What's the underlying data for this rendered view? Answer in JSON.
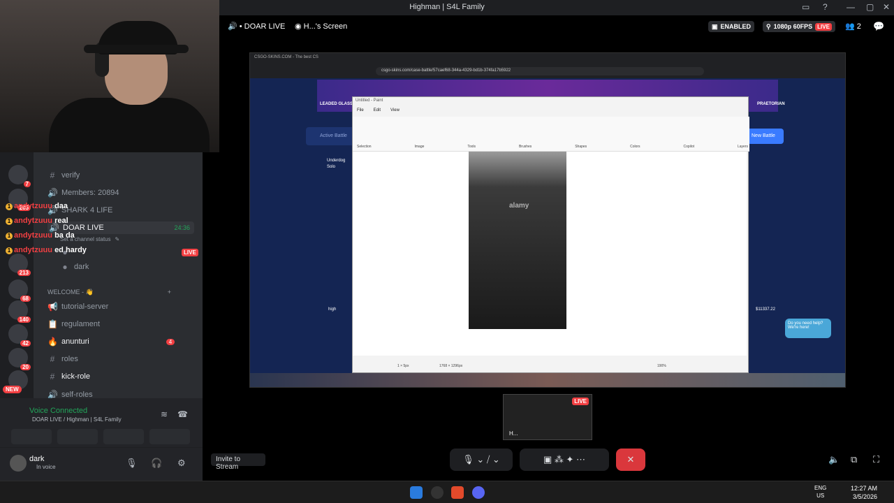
{
  "window": {
    "title": "Highman | S4L Family",
    "controls": [
      "—",
      "▢",
      "✕"
    ]
  },
  "stream_header": {
    "tab_live": "DOAR LIVE",
    "tab_screen": "H...'s Screen",
    "enabled": "ENABLED",
    "quality": "1080p 60FPS",
    "live": "LIVE",
    "viewers": "2"
  },
  "channels": {
    "items": [
      {
        "icon": "#",
        "label": "verify"
      },
      {
        "icon": "🔊",
        "label": "Members: 20894"
      },
      {
        "icon": "🔊",
        "label": "SHARK 4 LIFE"
      },
      {
        "icon": "🔊",
        "label": "DOAR LIVE",
        "time": "24:36"
      },
      {
        "icon": "",
        "label": "Set a channel status"
      },
      {
        "icon": "",
        "label": "dark"
      },
      {
        "icon": "",
        "label": "WELCOME - 👋"
      },
      {
        "icon": "📢",
        "label": "tutorial-server"
      },
      {
        "icon": "📋",
        "label": "regulament"
      },
      {
        "icon": "🔥",
        "label": "anunturi",
        "badge": "4"
      },
      {
        "icon": "#",
        "label": "roles"
      },
      {
        "icon": "#",
        "label": "kick-role"
      },
      {
        "icon": "🔊",
        "label": "self-roles"
      }
    ],
    "live_badge": "LIVE",
    "new_badge": "NEW"
  },
  "chat_overlay": [
    {
      "user": "andytzuuu",
      "msg": "daa"
    },
    {
      "user": "andytzuuu",
      "msg": "real"
    },
    {
      "user": "andytzuuu",
      "msg": "ba da"
    },
    {
      "user": "andytzuuu",
      "msg": "ed hardy"
    }
  ],
  "server_badges": [
    "7",
    "205",
    "213",
    "68",
    "140",
    "42",
    "20"
  ],
  "voice": {
    "status": "Voice Connected",
    "channel": "DOAR LIVE / Highman | S4L Family"
  },
  "user": {
    "name": "dark",
    "status": "In voice"
  },
  "stream_content": {
    "url": "csgo-skins.com/case-battle/57caef68-344a-4329-bd1b-374fa17b5922",
    "tab": "CSGO-SKINS.COM - The best CS",
    "paint_title": "Untitled - Paint",
    "paint_menu": [
      "File",
      "Edit",
      "View"
    ],
    "paint_groups": [
      "Selection",
      "Image",
      "Tools",
      "Brushes",
      "Shapes",
      "Colors",
      "Copilot",
      "Layers"
    ],
    "site_labels": [
      "LEADED GLASS",
      "PRAETORIAN",
      "Active Battle",
      "New Battle",
      "Underdog",
      "Solo",
      "high",
      "$11337.22"
    ],
    "help_text": "Do you need help? We're here!",
    "watermark": "alamy",
    "status_dims": "1768 × 1296px",
    "status_zoom": "190%",
    "status_sel": "1 × 5px"
  },
  "controls": {
    "invite": "Invite to Stream",
    "thumb_live": "LIVE",
    "thumb_label": "H..."
  },
  "taskbar": {
    "lang": "ENG",
    "region": "US",
    "time": "12:27 AM",
    "date": "3/5/2026"
  }
}
